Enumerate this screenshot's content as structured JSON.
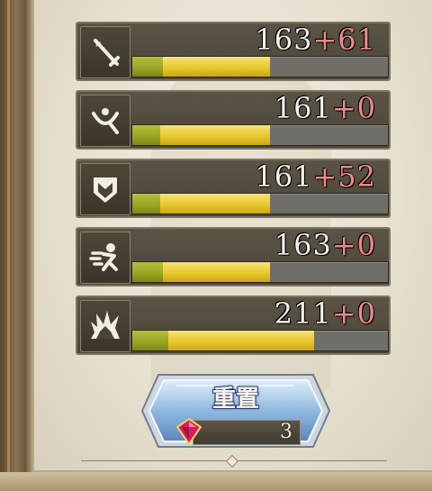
{
  "stats": [
    {
      "name": "attack",
      "icon": "sword-icon",
      "base": "163",
      "bonus": "+61",
      "base_fraction": 0.12,
      "total_fraction": 0.54
    },
    {
      "name": "speed",
      "icon": "arc-weapon-icon",
      "base": "161",
      "bonus": "+0",
      "base_fraction": 0.11,
      "total_fraction": 0.54
    },
    {
      "name": "defense",
      "icon": "shield-icon",
      "base": "161",
      "bonus": "+52",
      "base_fraction": 0.11,
      "total_fraction": 0.54
    },
    {
      "name": "agility",
      "icon": "running-figure-icon",
      "base": "163",
      "bonus": "+0",
      "base_fraction": 0.12,
      "total_fraction": 0.54
    },
    {
      "name": "resistance",
      "icon": "burst-icon",
      "base": "211",
      "bonus": "+0",
      "base_fraction": 0.14,
      "total_fraction": 0.71
    }
  ],
  "merge": {
    "label": "重置",
    "count": "3",
    "gem_icon": "red-gem-icon"
  },
  "colors": {
    "bonus_text": "#f28a8a",
    "bar_fill": "#e8c82c",
    "bar_base": "#98a322"
  }
}
